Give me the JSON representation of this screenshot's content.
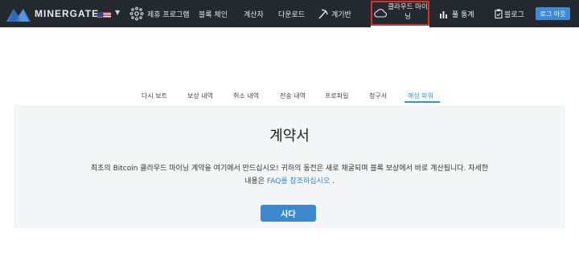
{
  "brand": {
    "name": "MINERGATE"
  },
  "nav": {
    "language_flag": "us-flag-icon",
    "items": [
      {
        "label": "제휴 프로그램",
        "icon": "network-icon"
      },
      {
        "label": "블록 체인",
        "icon": ""
      },
      {
        "label": "계산자",
        "icon": ""
      },
      {
        "label": "다운로드",
        "icon": ""
      },
      {
        "label": "계기반",
        "icon": "pickaxe-icon"
      },
      {
        "label": "클라우드 마이닝",
        "icon": "cloud-icon"
      },
      {
        "label": "풀 통계",
        "icon": "bar-chart-icon"
      },
      {
        "label": "블로그",
        "icon": "clipboard-icon"
      }
    ],
    "logout_label": "로그 아웃"
  },
  "tabs": [
    {
      "label": "다시 보트"
    },
    {
      "label": "보상 내역"
    },
    {
      "label": "취소 내역"
    },
    {
      "label": "전송 내역"
    },
    {
      "label": "프로파일"
    },
    {
      "label": "청구서"
    },
    {
      "label": "해싱 파워"
    }
  ],
  "active_tab": "해싱 파워",
  "panel": {
    "title": "계약서",
    "text_before_link": "최초의 Bitcoin 클라우드 마이닝 계약을 여기에서 만드십시오! 귀하의 동전은 새로 채굴되며 블록 보상에서 바로 계산됩니다. 자세한 내용은 ",
    "link_text": "FAQ를 참조하십시오",
    "text_after_link": " .",
    "buy_label": "사다"
  },
  "colors": {
    "topbar": "#24292f",
    "accent": "#3d89d0",
    "active_tab": "#2f9bd6",
    "highlight_border": "#d0342c",
    "panel_bg": "#f4f5f6"
  }
}
